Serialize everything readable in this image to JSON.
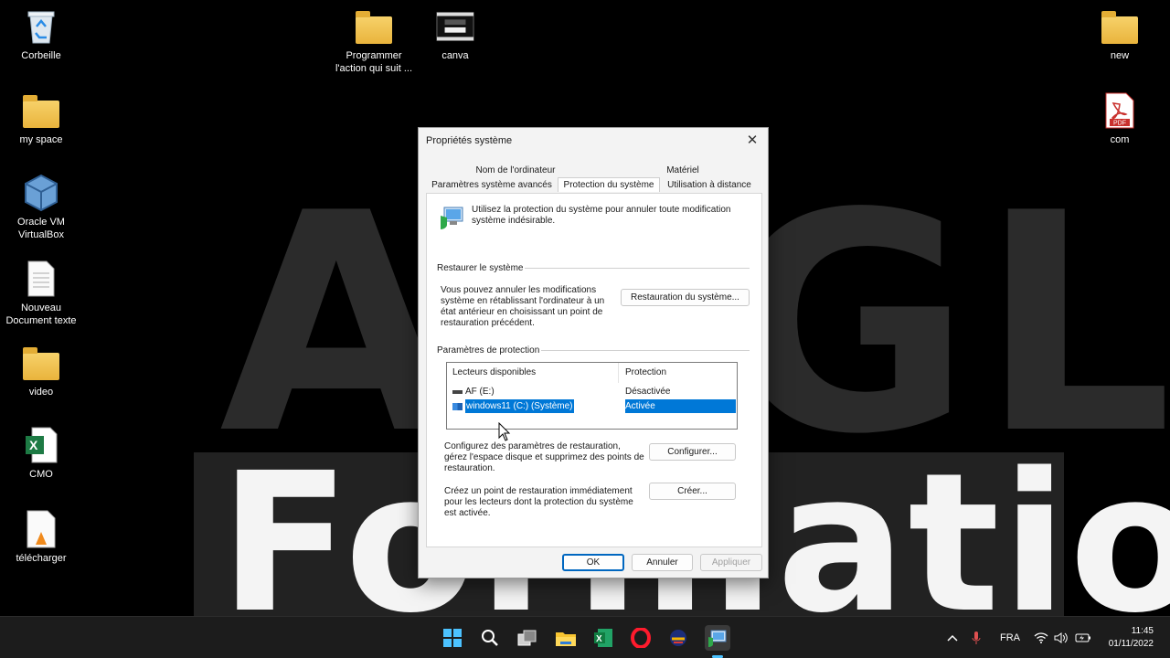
{
  "wallpaper": {
    "top_text": "ANGLE",
    "bottom_text": "Formation"
  },
  "desktop": {
    "icons": [
      {
        "label": "Corbeille",
        "icon": "recycle-bin-icon"
      },
      {
        "label": "my space",
        "icon": "folder-icon"
      },
      {
        "label": "Oracle VM VirtualBox",
        "icon": "virtualbox-icon"
      },
      {
        "label": "Nouveau Document texte",
        "icon": "text-document-icon"
      },
      {
        "label": "video",
        "icon": "folder-icon"
      },
      {
        "label": "CMO",
        "icon": "excel-file-icon"
      },
      {
        "label": "télécharger",
        "icon": "vlc-file-icon"
      },
      {
        "label": "Programmer l'action qui suit ...",
        "icon": "folder-icon"
      },
      {
        "label": "canva",
        "icon": "image-file-icon"
      },
      {
        "label": "new",
        "icon": "folder-icon"
      },
      {
        "label": "com",
        "icon": "pdf-file-icon"
      }
    ]
  },
  "dialog": {
    "title": "Propriétés système",
    "tabs_top": [
      "Nom de l'ordinateur",
      "Matériel"
    ],
    "tabs_bottom": [
      "Paramètres système avancés",
      "Protection du système",
      "Utilisation à distance"
    ],
    "active_tab": "Protection du système",
    "intro": "Utilisez la protection du système pour annuler toute modification système indésirable.",
    "restore_group": "Restaurer le système",
    "restore_text": "Vous pouvez annuler les modifications système en rétablissant l'ordinateur à un état antérieur en choisissant un point de restauration précédent.",
    "restore_button": "Restauration du système...",
    "protection_group": "Paramètres de protection",
    "table": {
      "headers": [
        "Lecteurs disponibles",
        "Protection"
      ],
      "rows": [
        {
          "drive": "AF (E:)",
          "protection": "Désactivée",
          "selected": false
        },
        {
          "drive": "windows11 (C:) (Système)",
          "protection": "Activée",
          "selected": true
        }
      ]
    },
    "configure_text": "Configurez des paramètres de restauration, gérez l'espace disque et supprimez des points de restauration.",
    "configure_button": "Configurer...",
    "create_text": "Créez un point de restauration immédiatement pour les lecteurs dont la protection du système est activée.",
    "create_button": "Créer...",
    "ok_button": "OK",
    "cancel_button": "Annuler",
    "apply_button": "Appliquer"
  },
  "taskbar": {
    "apps": [
      "start-icon",
      "search-icon",
      "task-view-icon",
      "file-explorer-icon",
      "excel-icon",
      "opera-icon",
      "app-icon",
      "system-properties-icon"
    ],
    "language": "FRA",
    "time": "11:45",
    "date": "01/11/2022"
  },
  "colors": {
    "accent": "#0067c0",
    "selection": "#0078d7"
  }
}
